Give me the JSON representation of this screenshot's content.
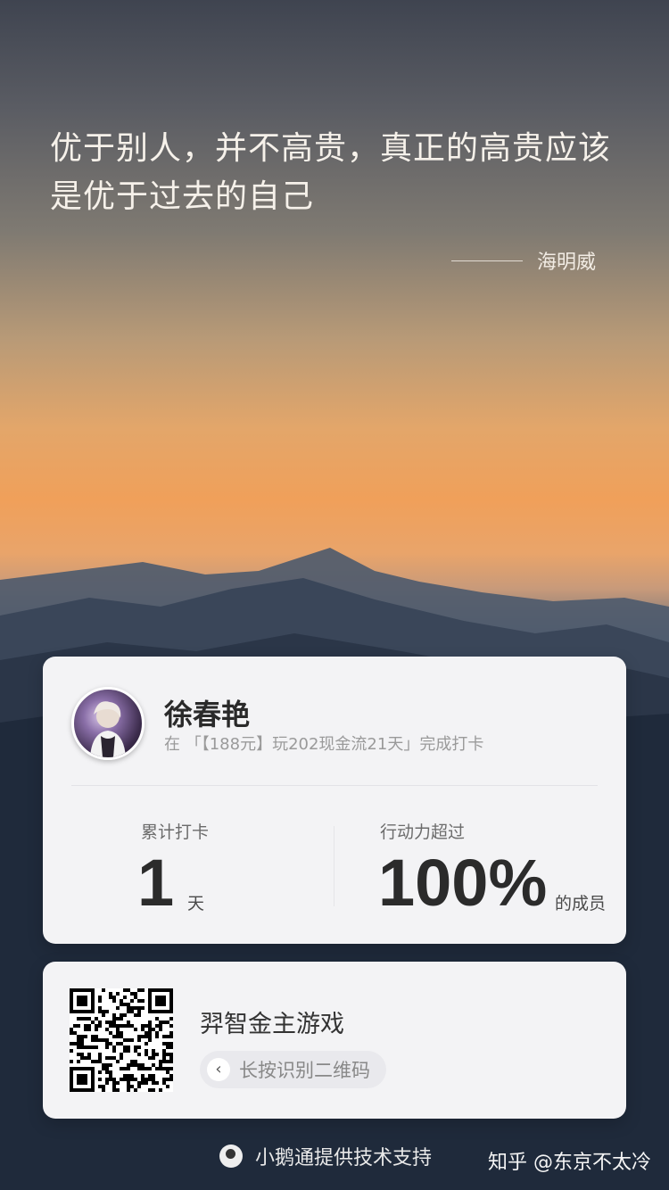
{
  "quote": {
    "line1": "优于别人，并不高贵，真正的高贵应该",
    "line2": "是优于过去的自己",
    "author": "海明威"
  },
  "profile": {
    "name": "徐春艳",
    "subline": "在 「【188元】玩202现金流21天」完成打卡"
  },
  "stats": {
    "checkin_label": "累计打卡",
    "checkin_value": "1",
    "checkin_unit": "天",
    "action_label": "行动力超过",
    "action_value": "100%",
    "action_unit": "的成员"
  },
  "promo": {
    "title": "羿智金主游戏",
    "hint": "长按识别二维码"
  },
  "footer": {
    "support": "小鹅通提供技术支持",
    "watermark": "知乎 @东京不太冷"
  },
  "colors": {
    "card_bg": "#f3f3f5",
    "sky_orange": "#f0a05a",
    "text_dark": "#2b2b2b"
  },
  "icons": {
    "back": "chevron-left-icon",
    "logo": "xiaoe-logo-icon"
  }
}
